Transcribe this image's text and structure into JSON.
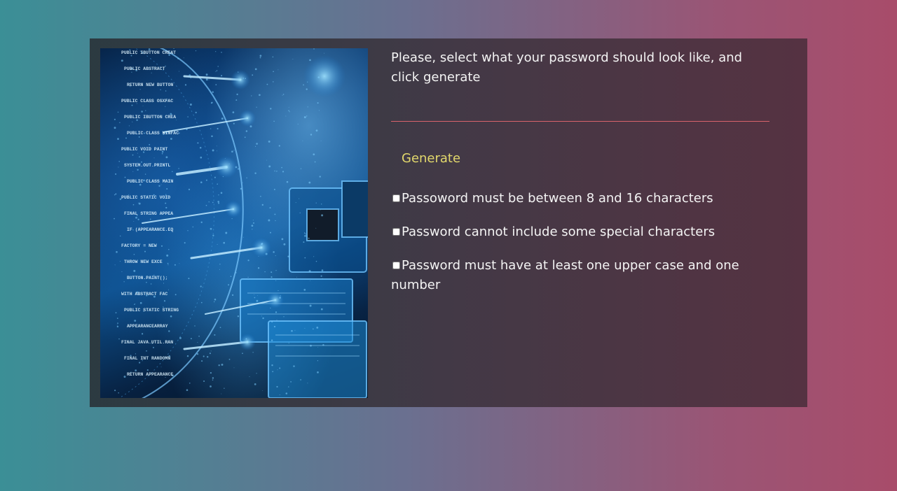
{
  "page": {
    "instruction": "Please, select what your password should look like, and click generate",
    "password_value": "",
    "generate_label": "Generate",
    "options": [
      {
        "label": "Passoword must be between 8 and 16 characters",
        "checked": false
      },
      {
        "label": "Password cannot include some special characters",
        "checked": false
      },
      {
        "label": "Password must have at least one upper case and one number",
        "checked": false
      }
    ]
  },
  "image": {
    "subject": "circuit board with code overlay",
    "code_lines": [
      "PUBLIC IBUTTON CREAT",
      "PUBLIC ABSTRACT",
      "RETURN NEW BUTTON",
      "PUBLIC CLASS OSXFAC",
      "PUBLIC IBUTTON CREA",
      "PUBLIC CLASS WINFAC",
      "PUBLIC VOID PAINT",
      "SYSTEM.OUT.PRINTL",
      "PUBLIC CLASS MAIN",
      "PUBLIC STATIC VOID",
      "FINAL STRING APPEA",
      "IF (APPEARANCE.EQ",
      "FACTORY = NEW",
      "THROW NEW EXCE",
      "BUTTON.PAINT();",
      "WITH ABSTRACT FAC",
      "PUBLIC STATIC STRING",
      "APPEARANCEARRAY",
      "FINAL JAVA.UTIL.RAN",
      "FINAL INT RANDOMN",
      "RETURN APPEARANCE"
    ]
  },
  "colors": {
    "accent": "#e2d86c",
    "divider": "#d8636b",
    "text": "#f4f4f4"
  }
}
